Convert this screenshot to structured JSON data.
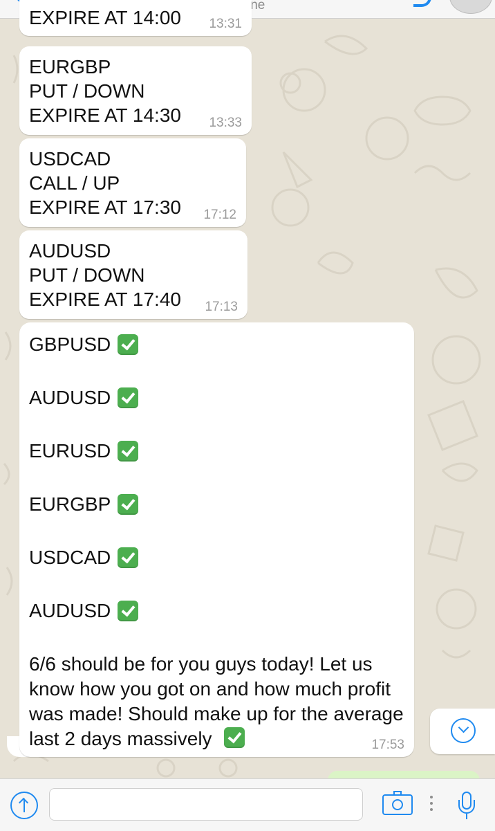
{
  "header": {
    "status": "online"
  },
  "messages": [
    {
      "lines": [
        "EXPIRE AT 14:00"
      ],
      "time": "13:31"
    },
    {
      "lines": [
        "EURGBP",
        "PUT / DOWN",
        "EXPIRE AT 14:30"
      ],
      "time": "13:33"
    },
    {
      "lines": [
        "USDCAD",
        "CALL / UP",
        "EXPIRE AT 17:30"
      ],
      "time": "17:12"
    },
    {
      "lines": [
        "AUDUSD",
        "PUT / DOWN",
        "EXPIRE AT 17:40"
      ],
      "time": "17:13"
    }
  ],
  "results": {
    "pairs": [
      "GBPUSD",
      "AUDUSD",
      "EURUSD",
      "EURGBP",
      "USDCAD",
      "AUDUSD"
    ],
    "check_icon": "white-heavy-check-mark",
    "message": "6/6 should be for you guys today! Let us know how you got on and how much profit was made! Should make up for the average last 2 days massively",
    "time": "17:53"
  },
  "composer": {
    "placeholder": ""
  },
  "colors": {
    "accent": "#1f8af0",
    "check": "#4cae4f",
    "bubble": "#ffffff",
    "wallpaper": "#e7e2d6"
  }
}
